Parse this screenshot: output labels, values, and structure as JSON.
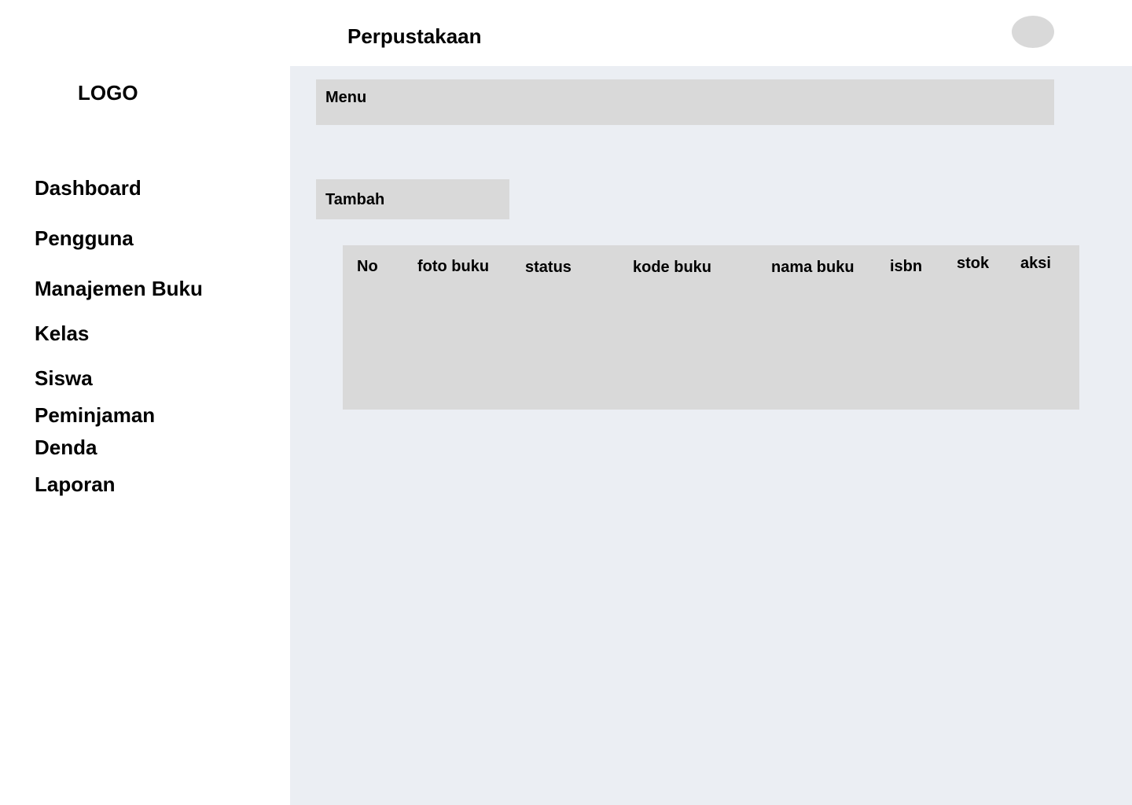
{
  "header": {
    "title": "Perpustakaan"
  },
  "sidebar": {
    "logo": "LOGO",
    "items": [
      {
        "label": "Dashboard"
      },
      {
        "label": "Pengguna"
      },
      {
        "label": "Manajemen Buku"
      },
      {
        "label": "Kelas"
      },
      {
        "label": "Siswa"
      },
      {
        "label": "Peminjaman"
      },
      {
        "label": "Denda"
      },
      {
        "label": "Laporan"
      }
    ]
  },
  "main": {
    "menu_label": "Menu",
    "add_button_label": "Tambah",
    "table": {
      "columns": [
        "No",
        "foto buku",
        "status",
        "kode buku",
        "nama buku",
        "isbn",
        "stok",
        "aksi"
      ],
      "rows": []
    }
  },
  "colors": {
    "main_background": "#ebeef3",
    "panel": "#d9d9d9",
    "avatar": "#d9d9d9"
  }
}
